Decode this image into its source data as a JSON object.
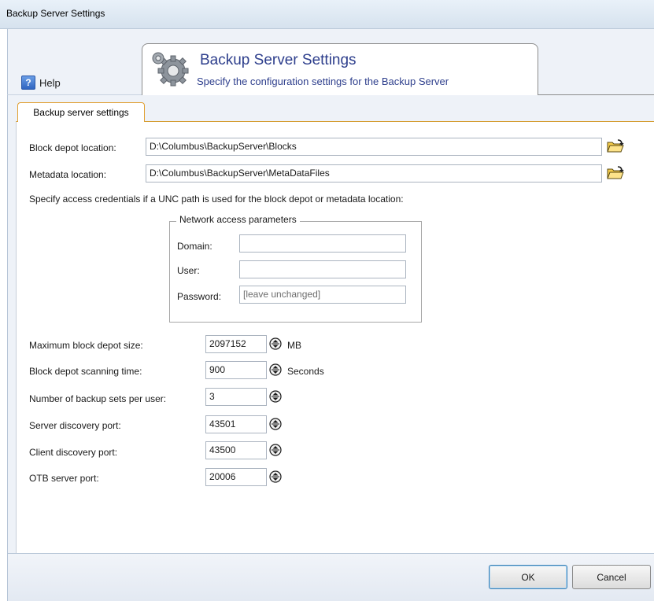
{
  "window": {
    "title": "Backup Server Settings"
  },
  "help": {
    "label": "Help"
  },
  "header": {
    "title": "Backup Server Settings",
    "subtitle": "Specify the configuration settings for the Backup Server",
    "icon": "gears-icon"
  },
  "tab": {
    "label": "Backup server settings"
  },
  "paths": {
    "block_depot_label": "Block depot location:",
    "block_depot_value": "D:\\Columbus\\BackupServer\\Blocks",
    "metadata_label": "Metadata location:",
    "metadata_value": "D:\\Columbus\\BackupServer\\MetaDataFiles",
    "browse_icon": "open-folder-icon"
  },
  "credentials_note": "Specify access credentials if a UNC path is used for the block depot or metadata location:",
  "network": {
    "group_title": "Network access parameters",
    "domain_label": "Domain:",
    "domain_value": "",
    "user_label": "User:",
    "user_value": "",
    "password_label": "Password:",
    "password_placeholder": "[leave unchanged]"
  },
  "settings": [
    {
      "label": "Maximum block depot size:",
      "value": "2097152",
      "unit": "MB"
    },
    {
      "label": "Block depot scanning time:",
      "value": "900",
      "unit": "Seconds"
    },
    {
      "label": "Number of backup sets per user:",
      "value": "3",
      "unit": ""
    },
    {
      "label": "Server discovery port:",
      "value": "43501",
      "unit": ""
    },
    {
      "label": "Client discovery port:",
      "value": "43500",
      "unit": ""
    },
    {
      "label": "OTB server port:",
      "value": "20006",
      "unit": ""
    }
  ],
  "buttons": {
    "ok": "OK",
    "cancel": "Cancel"
  },
  "colors": {
    "header_text": "#2d3e8c",
    "tab_border": "#e0a033",
    "frame_bg": "#eef2f8"
  }
}
